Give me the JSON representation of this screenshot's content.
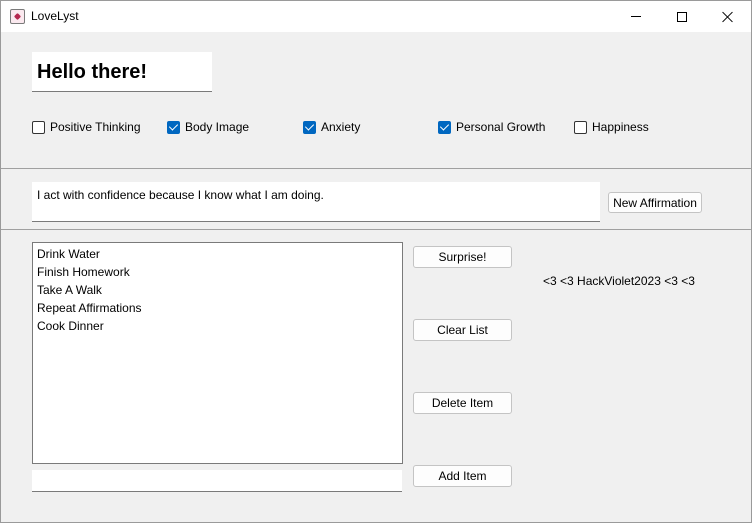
{
  "window": {
    "title": "LoveLyst"
  },
  "greeting": "Hello there!",
  "categories": [
    {
      "label": "Positive Thinking",
      "checked": false
    },
    {
      "label": "Body Image",
      "checked": true
    },
    {
      "label": "Anxiety",
      "checked": true
    },
    {
      "label": "Personal Growth",
      "checked": true
    },
    {
      "label": "Happiness",
      "checked": false
    }
  ],
  "affirmation": {
    "text": "I act with confidence because I know what I am doing.",
    "new_button": "New Affirmation"
  },
  "todo": {
    "items": [
      "Drink Water",
      "Finish Homework",
      "Take A Walk",
      "Repeat Affirmations",
      "Cook Dinner"
    ],
    "input_value": "",
    "surprise_button": "Surprise!",
    "clear_button": "Clear List",
    "delete_button": "Delete Item",
    "add_button": "Add Item"
  },
  "tagline": "<3 <3 HackViolet2023 <3 <3",
  "colors": {
    "accent": "#0067c0",
    "background": "#f0f0f0"
  },
  "icons": {
    "app": "heart-app-icon"
  }
}
